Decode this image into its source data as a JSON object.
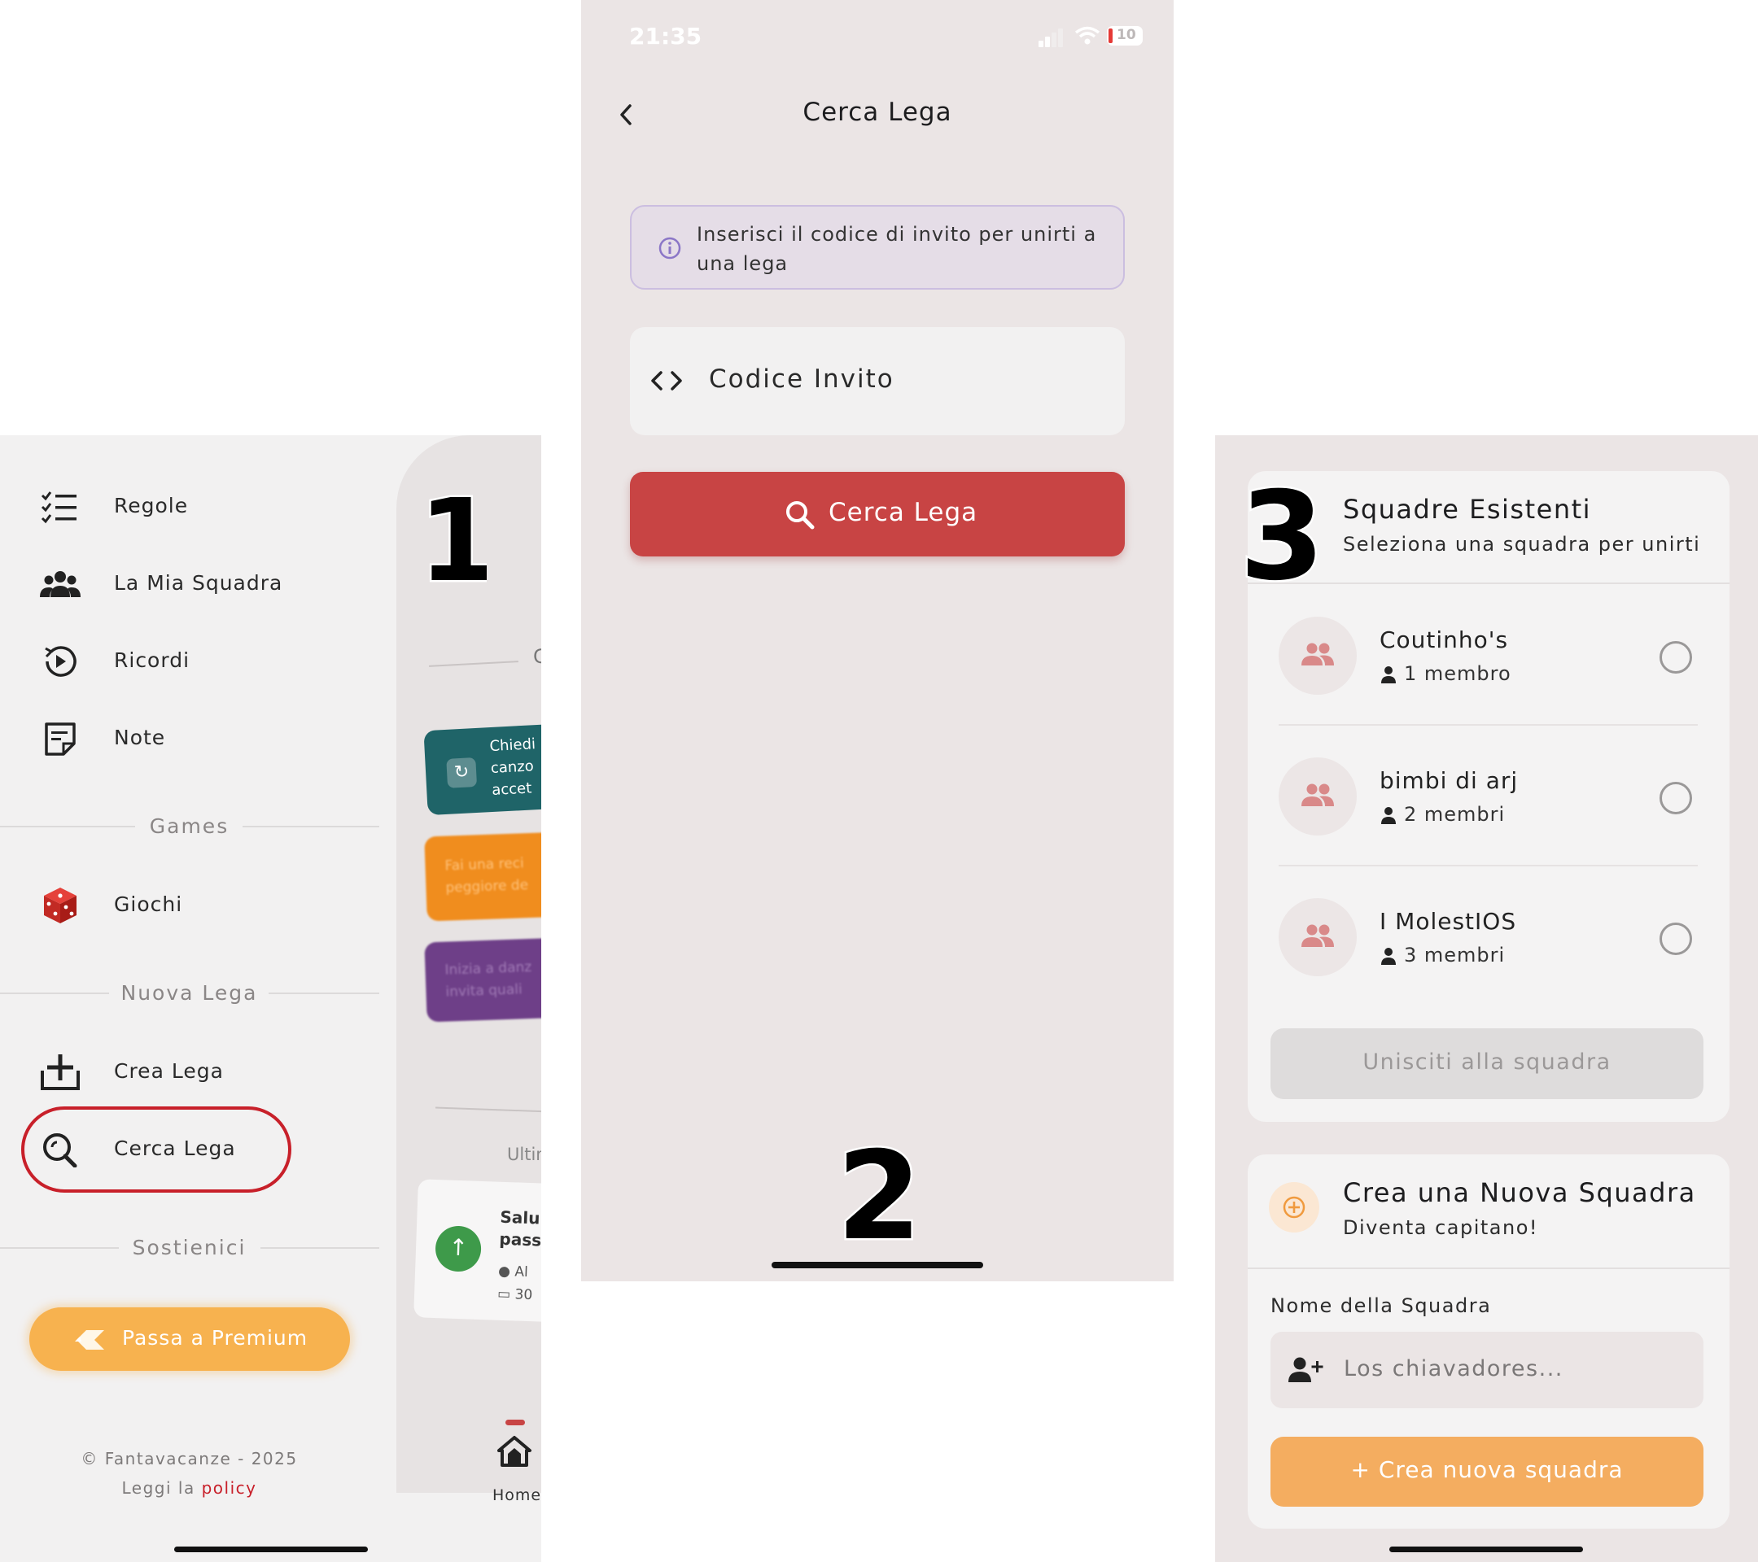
{
  "colors": {
    "accent_red": "#c84444",
    "premium_orange": "#f7b24f",
    "create_orange": "#f4ad60",
    "panel_bg": "#ebe5e5",
    "drawer_bg": "#f2f1f1"
  },
  "panel1": {
    "step_number": "1",
    "menu": [
      {
        "label": "Regole",
        "icon": "checklist-icon"
      },
      {
        "label": "La Mia Squadra",
        "icon": "team-icon"
      },
      {
        "label": "Ricordi",
        "icon": "history-play-icon"
      },
      {
        "label": "Note",
        "icon": "note-icon"
      }
    ],
    "sections": {
      "games": "Games",
      "new_league": "Nuova Lega",
      "support": "Sostienici"
    },
    "games_item": {
      "label": "Giochi",
      "icon": "dice-icon"
    },
    "create_league": {
      "label": "Crea Lega",
      "icon": "add-box-icon"
    },
    "search_league": {
      "label": "Cerca Lega",
      "icon": "search-icon"
    },
    "premium_button": "Passa a Premium",
    "footer_copyright": "© Fantavacanze - 2025",
    "footer_read": "Leggi la ",
    "footer_policy": "policy",
    "behind": {
      "partial_header": "C",
      "teal_card": [
        "Chiedi",
        "canzo",
        "accet"
      ],
      "orange_card": [
        "Fai una reci",
        "peggiore de"
      ],
      "purple_card": [
        "Inizia a danz",
        "invita quali"
      ],
      "last_label": "Ultim",
      "event_title": [
        "Salu",
        "pass"
      ],
      "event_user": "Al",
      "event_date": "30",
      "home_label": "Home"
    }
  },
  "panel2": {
    "step_number": "2",
    "status": {
      "time": "21:35",
      "battery": "10"
    },
    "title": "Cerca Lega",
    "info_text": "Inserisci il codice di invito per unirti a una lega",
    "code_placeholder": "Codice Invito",
    "search_button": "Cerca Lega"
  },
  "panel3": {
    "step_number": "3",
    "existing_title": "Squadre Esistenti",
    "existing_subtitle": "Seleziona una squadra per unirti",
    "teams": [
      {
        "name": "Coutinho's",
        "members": "1 membro"
      },
      {
        "name": "bimbi di arj",
        "members": "2 membri"
      },
      {
        "name": "I MolestIOS",
        "members": "3 membri"
      }
    ],
    "join_button": "Unisciti alla squadra",
    "create_title": "Crea una Nuova Squadra",
    "create_subtitle": "Diventa capitano!",
    "name_label": "Nome della Squadra",
    "name_placeholder": "Los chiavadores...",
    "create_button": "+ Crea nuova squadra"
  }
}
